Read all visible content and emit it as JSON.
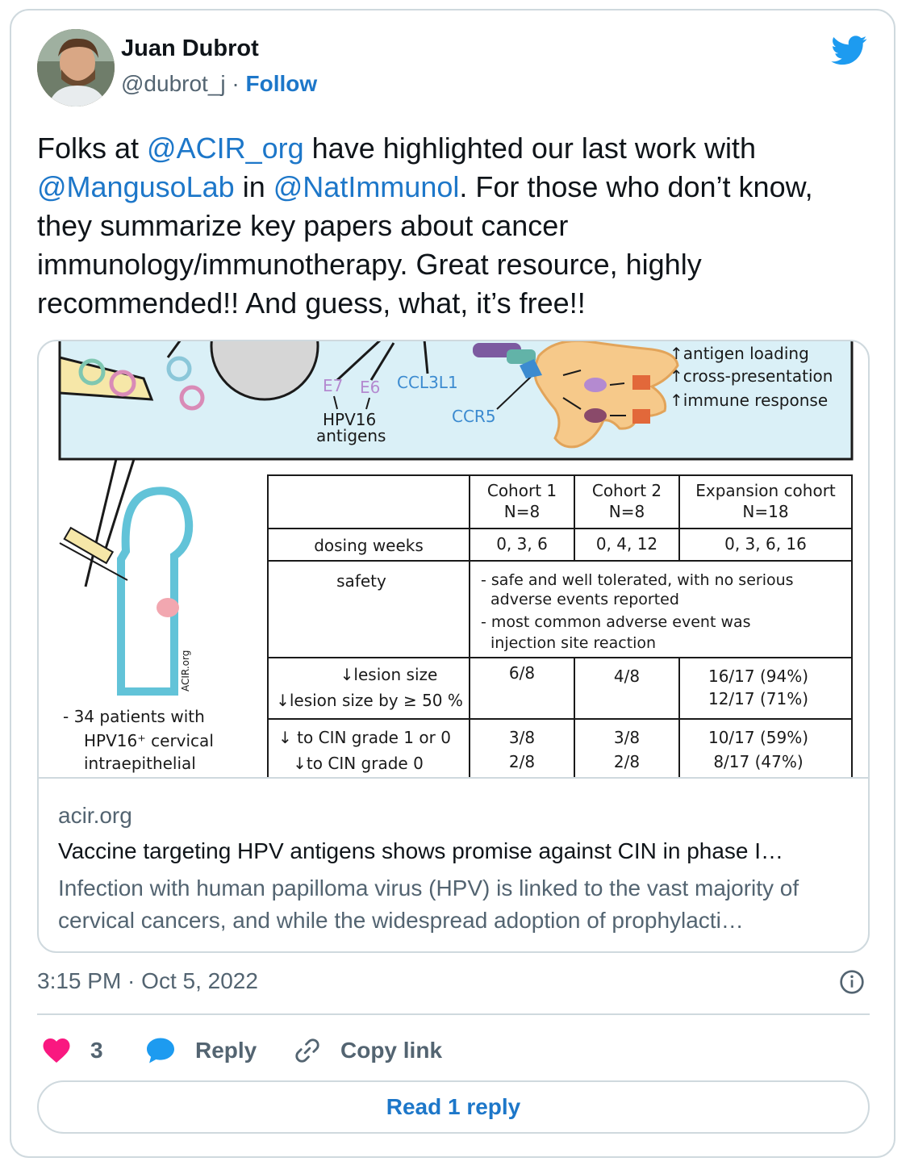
{
  "author": {
    "name": "Juan Dubrot",
    "handle": "@dubrot_j",
    "separator": "·",
    "follow_label": "Follow"
  },
  "tweet": {
    "text": {
      "t1": "Folks at ",
      "m1": "@ACIR_org",
      "t2": " have highlighted our last work with ",
      "m2": "@MangusoLab",
      "t3": " in ",
      "m3": "@NatImmunol",
      "t4": ". For those who don’t know, they summarize key papers about cancer immunology/immunotherapy. Great resource, highly recommended!! And guess, what, it’s free!!"
    },
    "timestamp": "3:15 PM · Oct 5, 2022"
  },
  "link_card": {
    "domain": "acir.org",
    "title": "Vaccine targeting HPV antigens shows promise against CIN in phase I…",
    "description": "Infection with human papilloma virus (HPV) is linked to the vast majority of cervical cancers, and while the widespread adoption of prophylacti…",
    "figure": {
      "labels": {
        "e7": "E7",
        "e6": "E6",
        "ccl3l1": "CCL3L1",
        "hpv16": "HPV16",
        "antigens": "antigens",
        "ccr5": "CCR5",
        "up1": "↑antigen loading",
        "up2": "↑cross-presentation",
        "up3": "↑immune response",
        "watermark": "ACIR.org",
        "patients1": "- 34 patients with",
        "patients2": "HPV16⁺ cervical",
        "patients3": "intraepithelial"
      },
      "table": {
        "headers": [
          {
            "line1": "Cohort 1",
            "line2": "N=8"
          },
          {
            "line1": "Cohort 2",
            "line2": "N=8"
          },
          {
            "line1": "Expansion cohort",
            "line2": "N=18"
          }
        ],
        "dosing_label": "dosing weeks",
        "dosing": [
          "0, 3, 6",
          "0, 4, 12",
          "0, 3, 6, 16"
        ],
        "safety_label": "safety",
        "safety_lines": [
          "- safe and well tolerated, with no serious",
          "adverse events reported",
          "- most common adverse event was",
          "injection site reaction"
        ],
        "lesion_label1": "↓lesion size",
        "lesion_label2": "↓lesion size by ≥ 50 %",
        "lesion_c1": "6/8",
        "lesion_c2": "4/8",
        "lesion_exp1": "16/17 (94%)",
        "lesion_exp2": "12/17 (71%)",
        "cin_label1": "↓ to CIN grade 1 or 0",
        "cin_label2": "↓to CIN grade 0",
        "cin_c1a": "3/8",
        "cin_c1b": "2/8",
        "cin_c2a": "3/8",
        "cin_c2b": "2/8",
        "cin_exp1": "10/17 (59%)",
        "cin_exp2": "8/17 (47%)"
      }
    }
  },
  "actions": {
    "likes": "3",
    "reply_label": "Reply",
    "copy_label": "Copy link",
    "read_replies_label": "Read 1 reply"
  },
  "colors": {
    "accent": "#1d77c9",
    "like": "#f91880",
    "twitter_blue": "#1d9bf0",
    "figure_bg": "#daf0f7"
  },
  "icons": [
    "twitter-bird-icon",
    "info-icon",
    "heart-icon",
    "reply-bubble-icon",
    "link-icon"
  ]
}
